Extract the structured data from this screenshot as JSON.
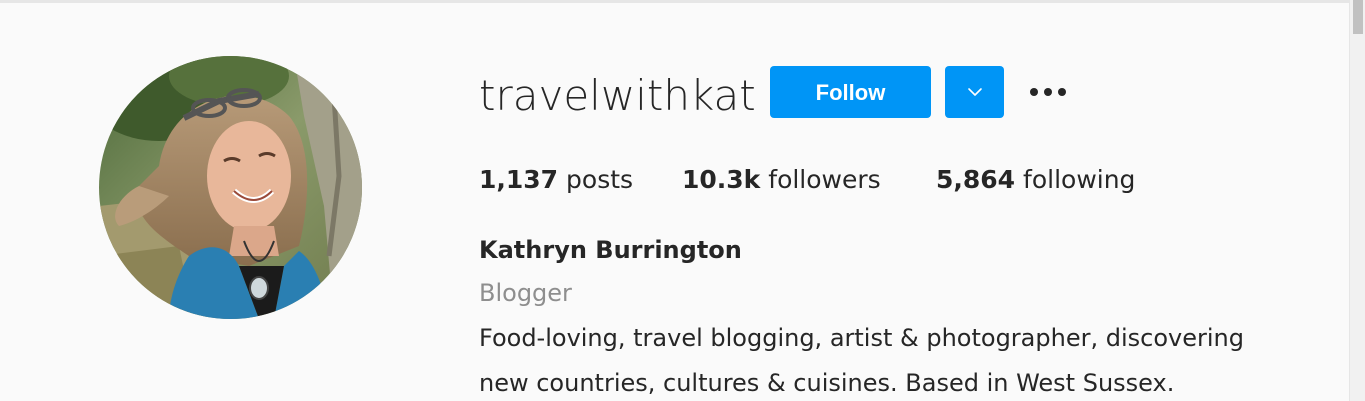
{
  "profile": {
    "username": "travelwithkat",
    "follow_label": "Follow",
    "stats": {
      "posts_count": "1,137",
      "posts_label": "posts",
      "followers_count": "10.3k",
      "followers_label": "followers",
      "following_count": "5,864",
      "following_label": "following"
    },
    "full_name": "Kathryn Burrington",
    "category": "Blogger",
    "bio_lines": [
      "Food-loving, travel blogging, artist & photographer, discovering",
      "new countries, cultures & cuisines. Based in West Sussex."
    ]
  },
  "colors": {
    "accent": "#0095f6",
    "background": "#fafafa",
    "text": "#262626",
    "muted": "#8e8e8e"
  },
  "icons": {
    "dropdown": "chevron-down-icon",
    "more": "more-options-icon"
  }
}
